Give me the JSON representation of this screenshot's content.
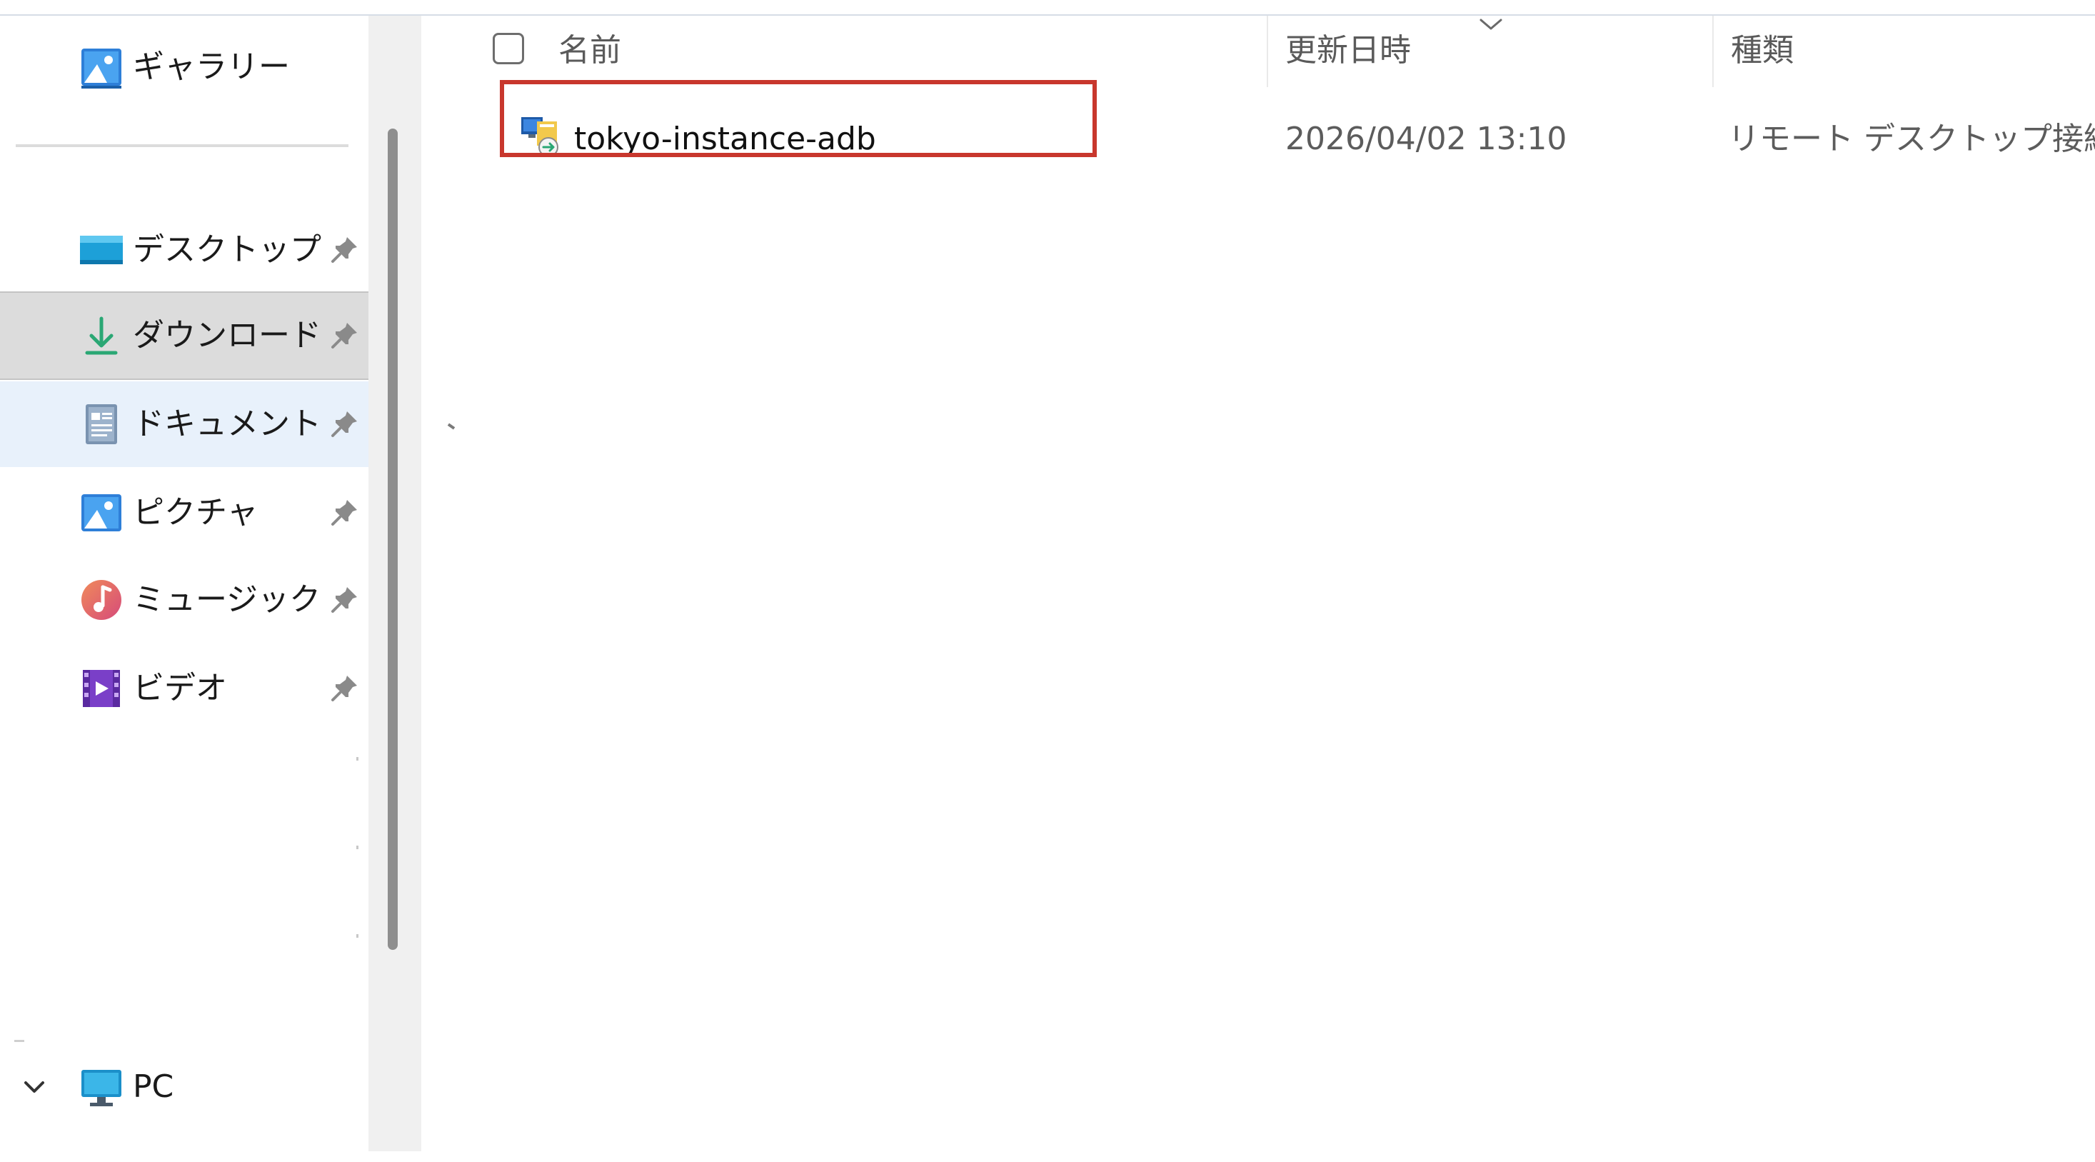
{
  "sidebar": {
    "gallery": {
      "label": "ギャラリー",
      "icon": "gallery-icon"
    },
    "quick_access": [
      {
        "label": "デスクトップ",
        "icon": "desktop-folder-icon",
        "pinned": true
      },
      {
        "label": "ダウンロード",
        "icon": "download-icon",
        "pinned": true,
        "selected": true
      },
      {
        "label": "ドキュメント",
        "icon": "document-icon",
        "pinned": true
      },
      {
        "label": "ピクチャ",
        "icon": "pictures-icon",
        "pinned": true
      },
      {
        "label": "ミュージック",
        "icon": "music-icon",
        "pinned": true
      },
      {
        "label": "ビデオ",
        "icon": "video-icon",
        "pinned": true
      }
    ],
    "pc": {
      "label": "PC",
      "icon": "pc-monitor-icon",
      "expanded": true
    }
  },
  "file_list": {
    "columns": {
      "name": "名前",
      "modified": "更新日時",
      "type": "種類"
    },
    "rows": [
      {
        "name": "tokyo-instance-adb",
        "modified": "2026/04/02 13:10",
        "type": "リモート デスクトップ接続",
        "icon": "remote-desktop-file-icon",
        "highlighted": true
      }
    ]
  },
  "colors": {
    "selection": "#dcdcdc",
    "hover": "#e8f1fb",
    "highlight_border": "#c8372d",
    "muted_text": "#5c5c5c"
  }
}
